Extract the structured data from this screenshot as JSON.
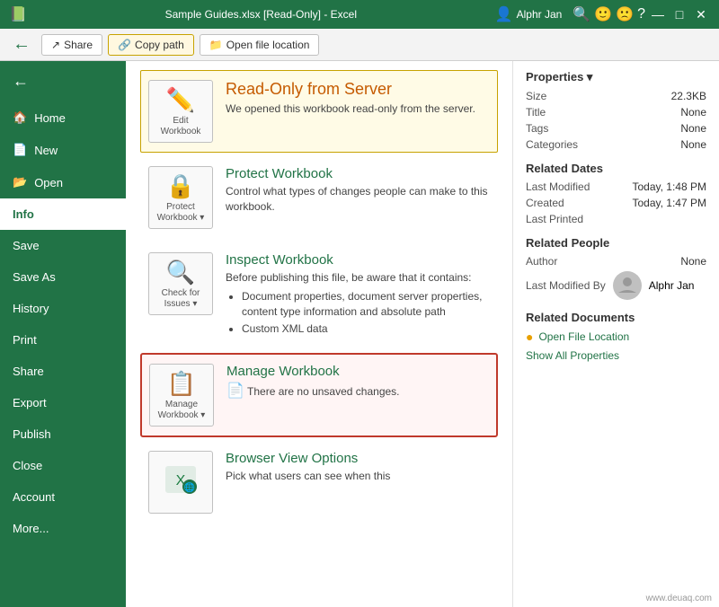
{
  "titlebar": {
    "filename": "Sample Guides.xlsx [Read-Only] - Excel",
    "username": "Alphr Jan",
    "minimize": "—",
    "maximize": "□",
    "close": "✕"
  },
  "toolbar": {
    "share_label": "Share",
    "copy_path_label": "Copy path",
    "open_file_location_label": "Open file location"
  },
  "sidebar": {
    "back_label": "←",
    "items": [
      {
        "label": "Home",
        "id": "home"
      },
      {
        "label": "New",
        "id": "new"
      },
      {
        "label": "Open",
        "id": "open"
      },
      {
        "label": "Info",
        "id": "info",
        "active": true
      },
      {
        "label": "Save",
        "id": "save"
      },
      {
        "label": "Save As",
        "id": "save-as"
      },
      {
        "label": "History",
        "id": "history"
      },
      {
        "label": "Print",
        "id": "print"
      },
      {
        "label": "Share",
        "id": "share"
      },
      {
        "label": "Export",
        "id": "export"
      },
      {
        "label": "Publish",
        "id": "publish"
      },
      {
        "label": "Close",
        "id": "close"
      },
      {
        "label": "Account",
        "id": "account"
      },
      {
        "label": "More...",
        "id": "more"
      }
    ]
  },
  "cards": {
    "readonly": {
      "title": "Read-Only from Server",
      "desc": "We opened this workbook read-only from the server.",
      "icon_label": "Edit\nWorkbook",
      "icon_symbol": "✏️"
    },
    "protect": {
      "title": "Protect Workbook",
      "desc": "Control what types of changes people can make to this workbook.",
      "icon_label": "Protect\nWorkbook ▾",
      "icon_symbol": "🔒"
    },
    "inspect": {
      "title": "Inspect Workbook",
      "desc": "Before publishing this file, be aware that it contains:",
      "desc_items": [
        "Document properties, document server properties, content type information and absolute path",
        "Custom XML data"
      ],
      "icon_label": "Check for\nIssues ▾",
      "icon_symbol": "🔍"
    },
    "manage": {
      "title": "Manage Workbook",
      "desc": "There are no unsaved changes.",
      "icon_label": "Manage\nWorkbook ▾",
      "icon_symbol": "📋"
    },
    "browser": {
      "title": "Browser View Options",
      "desc": "Pick what users can see when this",
      "icon_label": "",
      "icon_symbol": "🌐"
    }
  },
  "properties": {
    "section_title": "Properties ▾",
    "rows": [
      {
        "label": "Size",
        "value": "22.3KB"
      },
      {
        "label": "Title",
        "value": "None"
      },
      {
        "label": "Tags",
        "value": "None"
      },
      {
        "label": "Categories",
        "value": "None"
      }
    ],
    "related_dates_title": "Related Dates",
    "dates": [
      {
        "label": "Last Modified",
        "value": "Today, 1:48 PM"
      },
      {
        "label": "Created",
        "value": "Today, 1:47 PM"
      },
      {
        "label": "Last Printed",
        "value": ""
      }
    ],
    "related_people_title": "Related People",
    "author_label": "Author",
    "author_value": "None",
    "last_modified_label": "Last Modified By",
    "last_modified_user": "Alphr Jan",
    "related_docs_title": "Related Documents",
    "open_file_location": "Open File Location",
    "show_all": "Show All Properties"
  },
  "watermark": "www.deuaq.com"
}
